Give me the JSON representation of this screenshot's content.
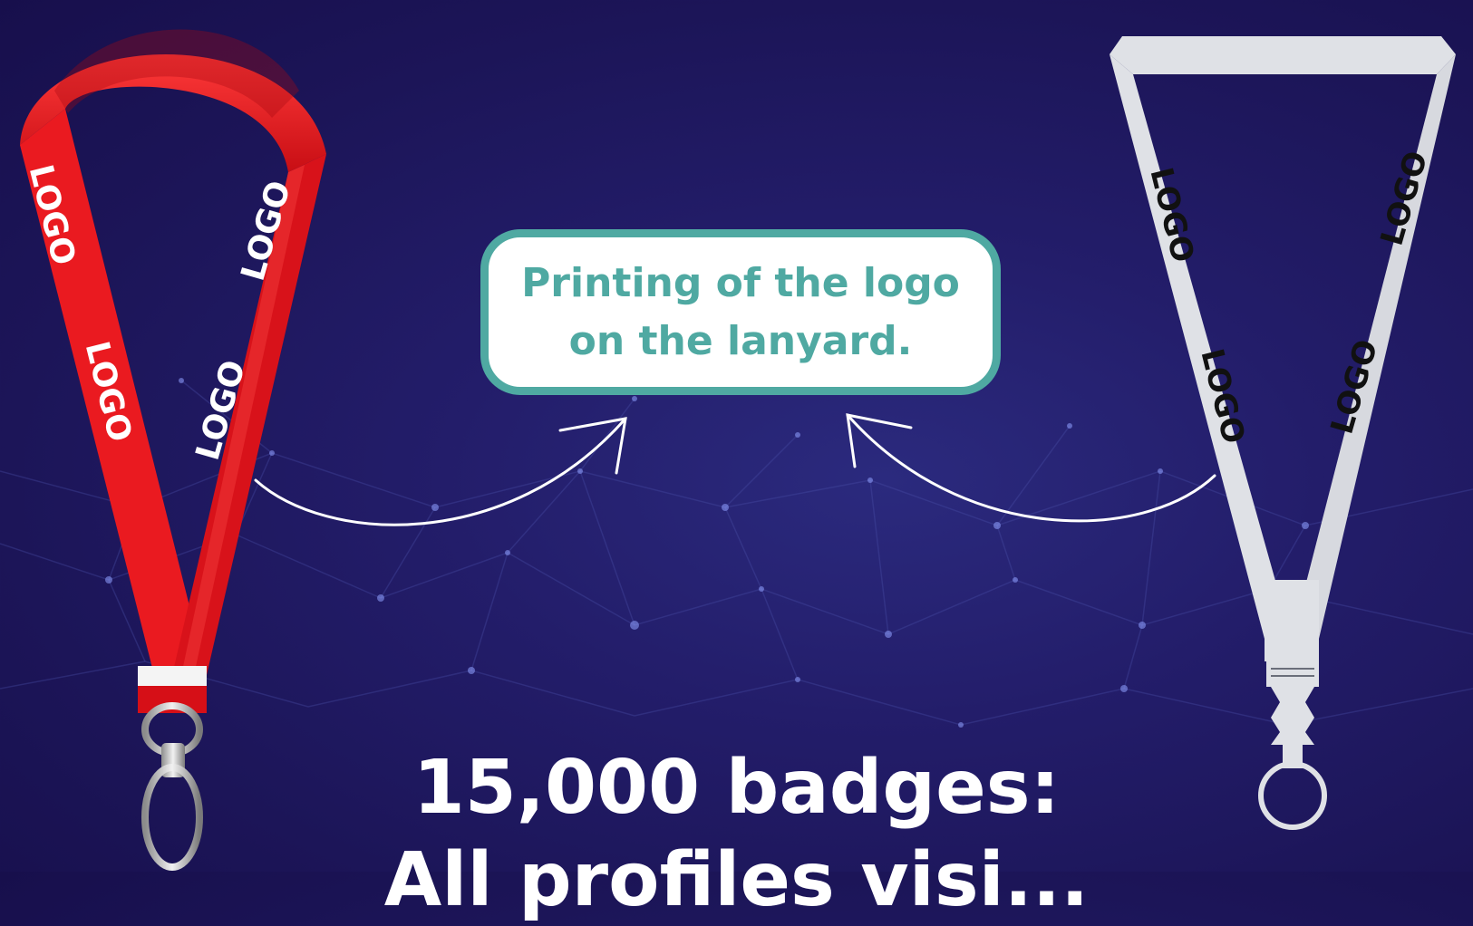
{
  "colors": {
    "accent_teal": "#4fa9a2",
    "lanyard_red": "#e8141c",
    "lanyard_white": "#dfe1e6",
    "background": "#1c1558"
  },
  "lanyards": {
    "red": {
      "logo_text": "LOGO",
      "logo_color": "#ffffff"
    },
    "white": {
      "logo_text": "LOGO",
      "logo_color": "#111111"
    }
  },
  "callout": {
    "text": "Printing of the logo on the lanyard."
  },
  "headline": {
    "line1": "15,000 badges:",
    "line2": "All profiles visi..."
  }
}
